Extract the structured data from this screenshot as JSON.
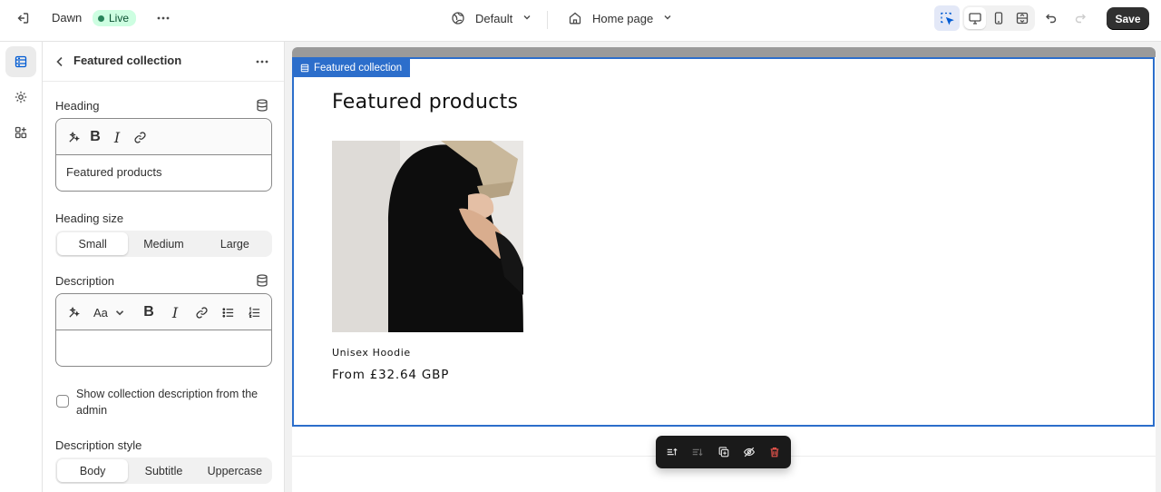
{
  "topbar": {
    "store_name": "Dawn",
    "status_badge": "Live",
    "theme_select": "Default",
    "page_select": "Home page",
    "save_label": "Save"
  },
  "panel": {
    "title": "Featured collection",
    "heading_label": "Heading",
    "heading_value": "Featured products",
    "heading_size_label": "Heading size",
    "heading_size_options": [
      "Small",
      "Medium",
      "Large"
    ],
    "heading_size_selected": "Small",
    "description_label": "Description",
    "description_value": "",
    "text_style_icon_label": "Aa",
    "show_description_label": "Show collection description from the admin",
    "show_description_checked": false,
    "description_style_label": "Description style",
    "description_style_options": [
      "Body",
      "Subtitle",
      "Uppercase"
    ],
    "description_style_selected": "Body"
  },
  "preview": {
    "section_tag": "Featured collection",
    "heading": "Featured products",
    "product": {
      "name": "Unisex Hoodie",
      "price": "From £32.64 GBP"
    }
  },
  "colors": {
    "accent": "#2c6ecb",
    "live_badge_bg": "#cdfee1",
    "save_button_bg": "#303030",
    "danger": "#e5534b"
  }
}
